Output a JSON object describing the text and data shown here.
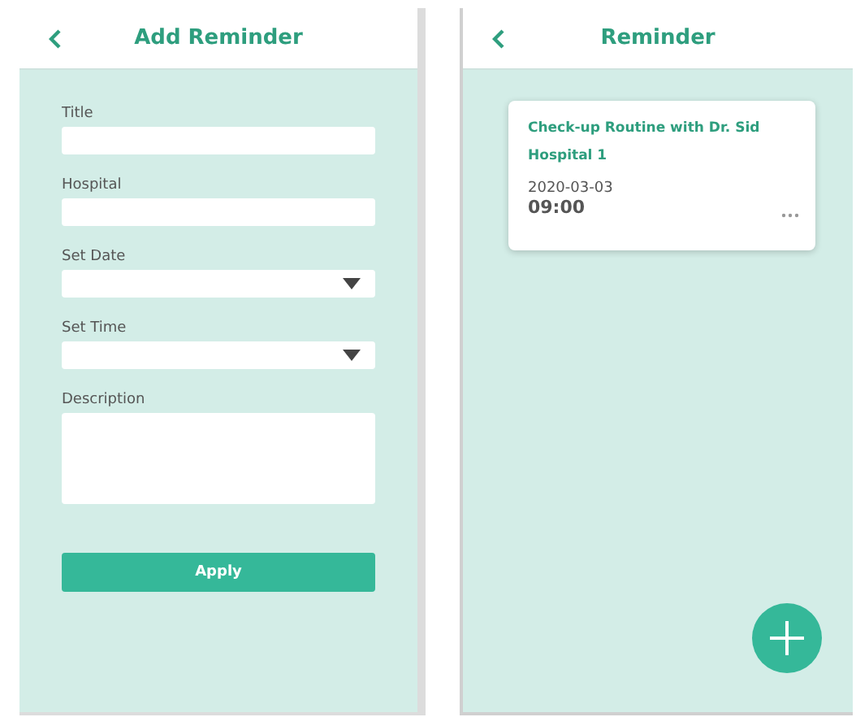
{
  "add_reminder_screen": {
    "title": "Add Reminder",
    "fields": [
      {
        "label": "Title",
        "kind": "text"
      },
      {
        "label": "Hospital",
        "kind": "text"
      },
      {
        "label": "Set Date",
        "kind": "select"
      },
      {
        "label": "Set Time",
        "kind": "select"
      },
      {
        "label": "Description",
        "kind": "textarea"
      }
    ],
    "apply_button": "Apply"
  },
  "reminder_screen": {
    "title": "Reminder",
    "reminders": [
      {
        "title": "Check-up Routine with Dr. Sid Hospital 1",
        "date": "2020-03-03",
        "time": "09:00"
      }
    ]
  }
}
